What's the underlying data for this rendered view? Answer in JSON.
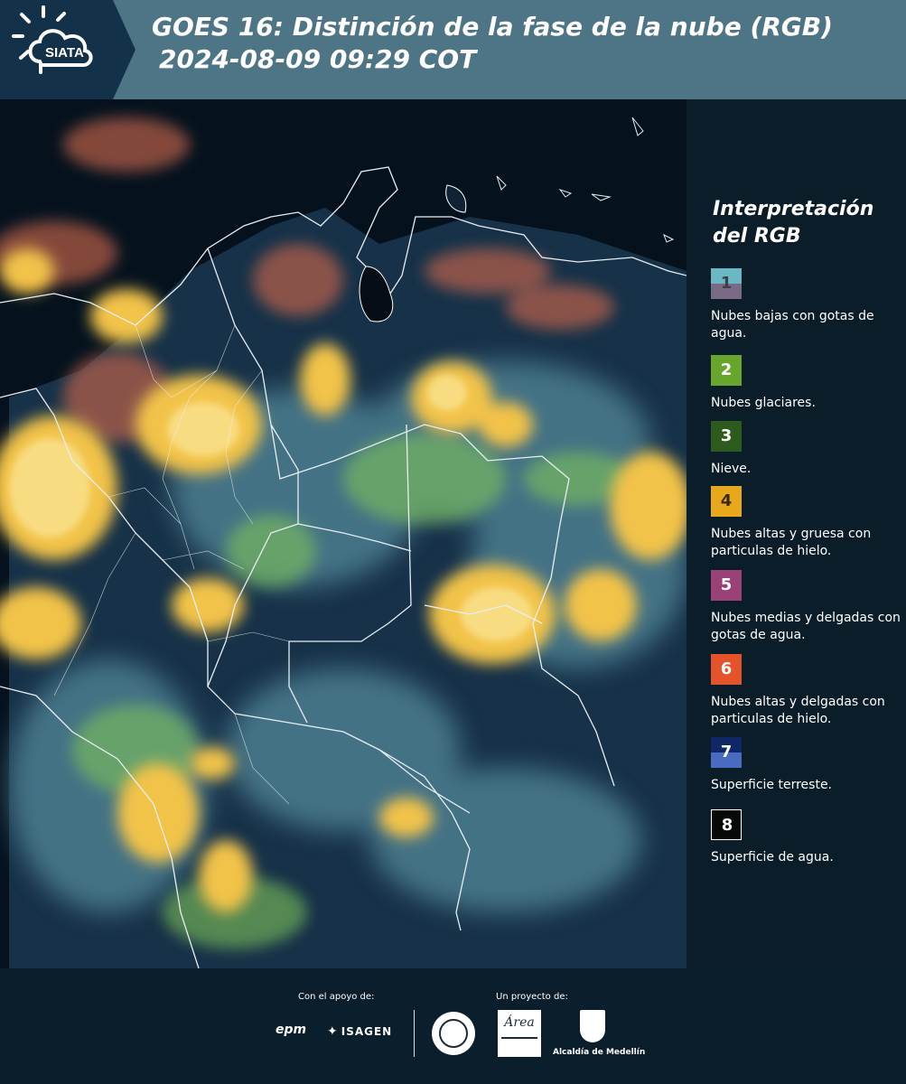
{
  "header": {
    "title": "GOES 16: Distinción de la fase de la nube (RGB)",
    "timestamp": "2024-08-09 09:29 COT",
    "logo_text": "SIATA",
    "colors": {
      "band": "#4e7585",
      "logo_panel": "#13324a"
    }
  },
  "legend": {
    "title": "Interpretación del RGB",
    "items": [
      {
        "number": "1",
        "label": "Nubes bajas con gotas de agua.",
        "color": "#6ab7c6",
        "color_bottom": "#7a6a86",
        "num_color": "#3b3f4a"
      },
      {
        "number": "2",
        "label": "Nubes glaciares.",
        "color": "#67a52d",
        "num_color": "#ffffff"
      },
      {
        "number": "3",
        "label": "Nieve.",
        "color": "#2d5a1d",
        "num_color": "#ffffff"
      },
      {
        "number": "4",
        "label": "Nubes altas y gruesa con particulas de hielo.",
        "color": "#e7a91b",
        "num_color": "#3b2a10"
      },
      {
        "number": "5",
        "label": "Nubes medias y delgadas con gotas de agua.",
        "color": "#9a4277",
        "num_color": "#ffffff"
      },
      {
        "number": "6",
        "label": "Nubes altas y delgadas con particulas de hielo.",
        "color": "#e5532a",
        "num_color": "#ffffff"
      },
      {
        "number": "7",
        "label": "Superficie terreste.",
        "color": "#0f2767",
        "color_bottom": "#4a6bc2",
        "num_color": "#ffffff"
      },
      {
        "number": "8",
        "label": "Superficie de agua.",
        "color": "#050a08",
        "border": "#ffffff",
        "num_color": "#ffffff"
      }
    ]
  },
  "footer": {
    "support_label": "Con el apoyo de:",
    "project_label": "Un proyecto de:",
    "epm_logo": "epm",
    "isagen_logo": "ISAGEN",
    "area_logo": "Área",
    "alcaldia_label": "Alcaldía de Medellín"
  },
  "map": {
    "colors": {
      "ocean": "#05121e",
      "land": "#1a3750",
      "low_cloud": "#6aa8b8",
      "glaciated": "#7fc25a",
      "thick_ice": "#f2c34a",
      "thin_ice": "#c9664b",
      "boundary": "#e8eef2"
    }
  }
}
